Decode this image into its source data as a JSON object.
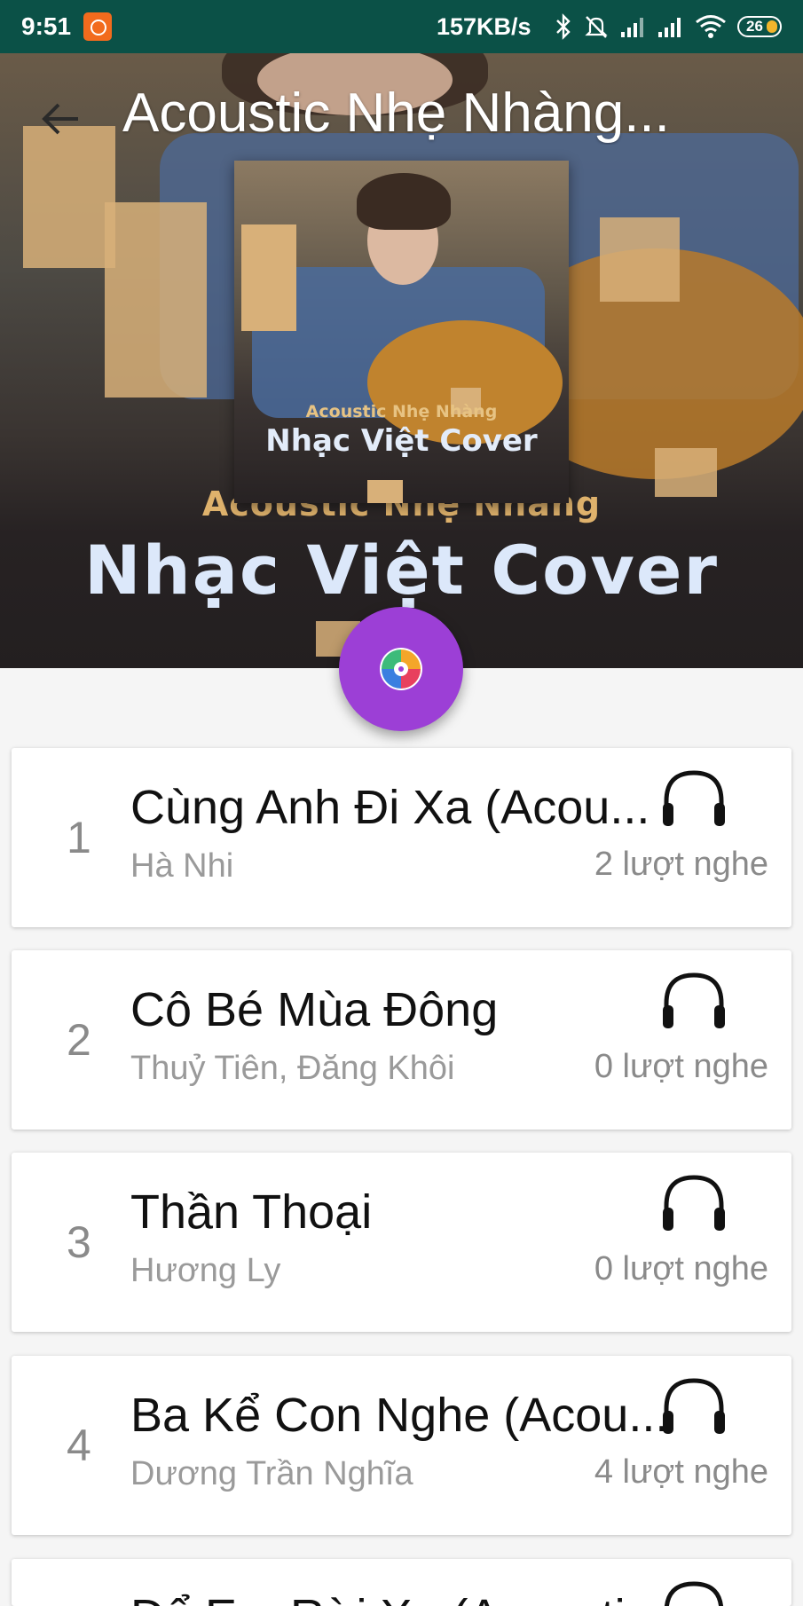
{
  "status_bar": {
    "time": "9:51",
    "network_speed": "157KB/s",
    "battery_level": "26",
    "icons": [
      "app-notification-icon",
      "bluetooth-icon",
      "mute-icon",
      "signal-icon",
      "signal-icon",
      "wifi-icon",
      "battery-icon"
    ]
  },
  "header": {
    "title": "Acoustic Nhẹ Nhàng...",
    "cover_subtitle": "Acoustic Nhẹ Nhàng",
    "cover_title": "Nhạc Việt Cover",
    "background_subtitle": "Acoustic Nhẹ Nhàng",
    "background_title": "Nhạc Việt Cover"
  },
  "fab": {
    "icon": "music-disc-icon"
  },
  "songs": [
    {
      "index": "1",
      "title": "Cùng Anh Đi Xa (Acou...",
      "artist": "Hà Nhi",
      "plays": "2 lượt nghe"
    },
    {
      "index": "2",
      "title": "Cô Bé Mùa Đông",
      "artist": "Thuỷ Tiên, Đăng Khôi",
      "plays": "0 lượt nghe"
    },
    {
      "index": "3",
      "title": "Thần Thoại",
      "artist": "Hương Ly",
      "plays": "0 lượt nghe"
    },
    {
      "index": "4",
      "title": "Ba Kể Con Nghe (Acou...",
      "artist": "Dương Trần Nghĩa",
      "plays": "4 lượt nghe"
    },
    {
      "index": "",
      "title": "Để Em Rời Xa (Acoustic",
      "artist": "",
      "plays": ""
    }
  ],
  "colors": {
    "status_bar": "#0b5147",
    "fab": "#9c3fd6",
    "background": "#f5f5f5"
  }
}
